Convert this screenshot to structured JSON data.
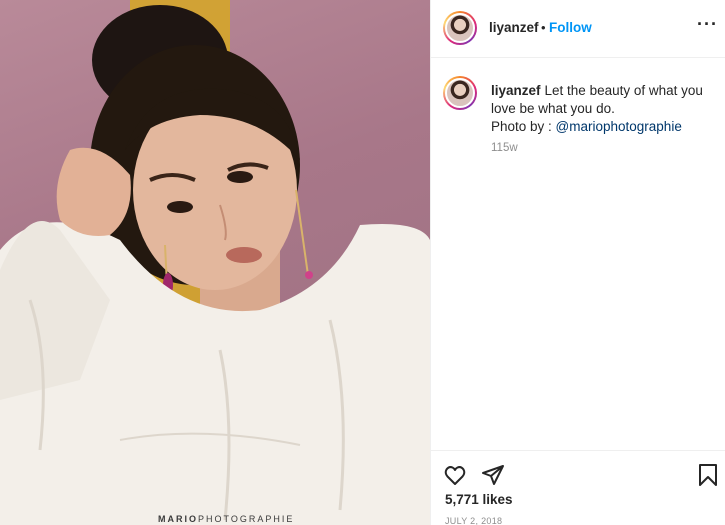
{
  "post": {
    "username": "liyanzef",
    "dot": "•",
    "follow_label": "Follow",
    "more_label": "···",
    "caption_username": "liyanzef",
    "caption_text": "Let the beauty of what you love be what you do.",
    "caption_credit": "Photo by : ",
    "caption_mention": "@mariophotographie",
    "age": "115w",
    "likes": "5,771 likes",
    "date": "JULY 2, 2018"
  },
  "photo": {
    "watermark_bold": "MARIO",
    "watermark_rest": "PHOTOGRAPHIE"
  },
  "icons": {
    "like": "heart-icon",
    "share": "paper-plane-icon",
    "save": "bookmark-icon",
    "more": "ellipsis-icon"
  },
  "colors": {
    "accent": "#0095f6",
    "mention": "#00376b",
    "muted": "#8e8e8e",
    "text": "#262626",
    "border": "#efefef"
  }
}
